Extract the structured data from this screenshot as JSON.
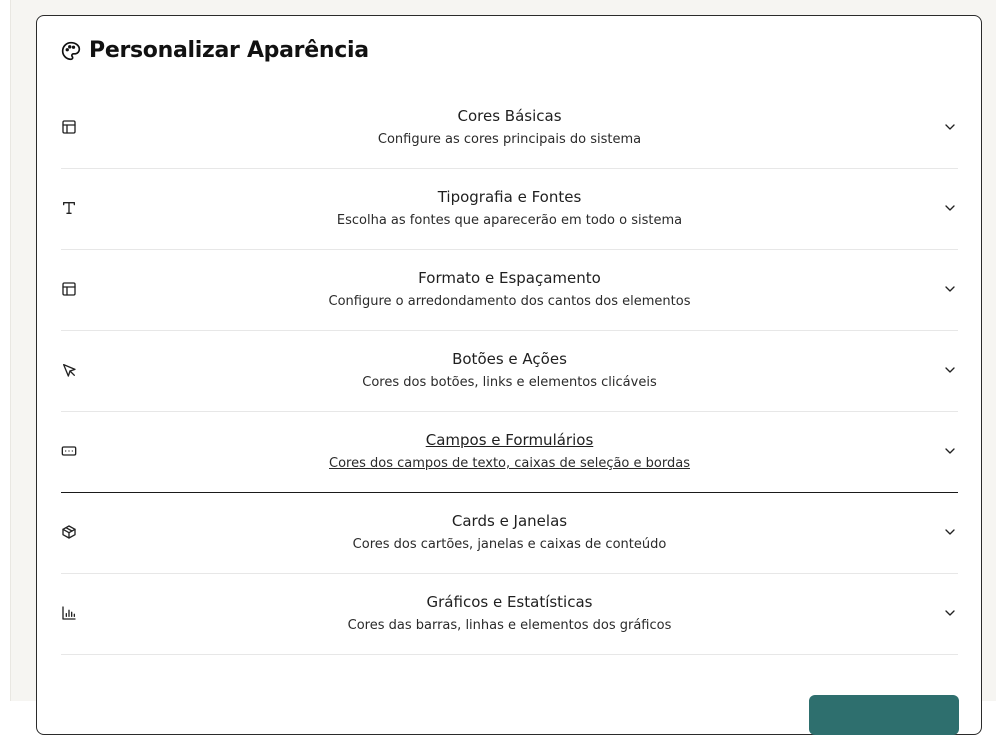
{
  "card": {
    "title": "Personalizar Aparência",
    "title_icon": "palette-icon"
  },
  "sections": [
    {
      "icon": "layout-icon",
      "name": "Cores Básicas",
      "description": "Configure as cores principais do sistema"
    },
    {
      "icon": "type-icon",
      "name": "Tipografia e Fontes",
      "description": "Escolha as fontes que aparecerão em todo o sistema"
    },
    {
      "icon": "layout-icon",
      "name": "Formato e Espaçamento",
      "description": "Configure o arredondamento dos cantos dos elementos"
    },
    {
      "icon": "cursor-icon",
      "name": "Botões e Ações",
      "description": "Cores dos botões, links e elementos clicáveis"
    },
    {
      "icon": "input-icon",
      "name": "Campos e Formulários",
      "description": "Cores dos campos de texto, caixas de seleção e bordas"
    },
    {
      "icon": "box-icon",
      "name": "Cards e Janelas",
      "description": "Cores dos cartões, janelas e caixas de conteúdo"
    },
    {
      "icon": "bar-chart-icon",
      "name": "Gráficos e Estatísticas",
      "description": "Cores das barras, linhas e elementos dos gráficos"
    }
  ],
  "colors": {
    "accent": "#2e6f6e",
    "border": "#2b2b2b",
    "background": "#f6f5f2"
  }
}
